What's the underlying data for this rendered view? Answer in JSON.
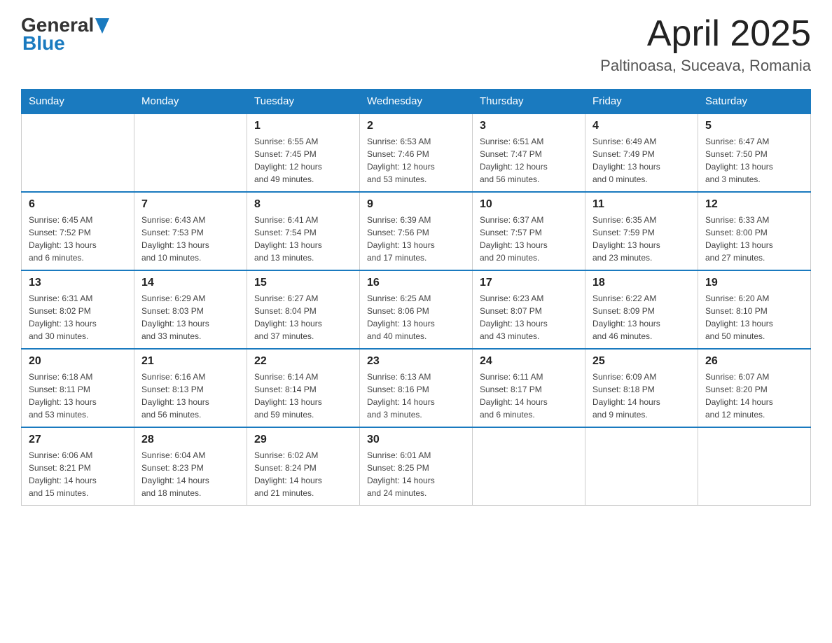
{
  "header": {
    "logo_general": "General",
    "logo_blue": "Blue",
    "month_title": "April 2025",
    "location": "Paltinoasa, Suceava, Romania"
  },
  "weekdays": [
    "Sunday",
    "Monday",
    "Tuesday",
    "Wednesday",
    "Thursday",
    "Friday",
    "Saturday"
  ],
  "weeks": [
    [
      {
        "day": "",
        "info": ""
      },
      {
        "day": "",
        "info": ""
      },
      {
        "day": "1",
        "info": "Sunrise: 6:55 AM\nSunset: 7:45 PM\nDaylight: 12 hours\nand 49 minutes."
      },
      {
        "day": "2",
        "info": "Sunrise: 6:53 AM\nSunset: 7:46 PM\nDaylight: 12 hours\nand 53 minutes."
      },
      {
        "day": "3",
        "info": "Sunrise: 6:51 AM\nSunset: 7:47 PM\nDaylight: 12 hours\nand 56 minutes."
      },
      {
        "day": "4",
        "info": "Sunrise: 6:49 AM\nSunset: 7:49 PM\nDaylight: 13 hours\nand 0 minutes."
      },
      {
        "day": "5",
        "info": "Sunrise: 6:47 AM\nSunset: 7:50 PM\nDaylight: 13 hours\nand 3 minutes."
      }
    ],
    [
      {
        "day": "6",
        "info": "Sunrise: 6:45 AM\nSunset: 7:52 PM\nDaylight: 13 hours\nand 6 minutes."
      },
      {
        "day": "7",
        "info": "Sunrise: 6:43 AM\nSunset: 7:53 PM\nDaylight: 13 hours\nand 10 minutes."
      },
      {
        "day": "8",
        "info": "Sunrise: 6:41 AM\nSunset: 7:54 PM\nDaylight: 13 hours\nand 13 minutes."
      },
      {
        "day": "9",
        "info": "Sunrise: 6:39 AM\nSunset: 7:56 PM\nDaylight: 13 hours\nand 17 minutes."
      },
      {
        "day": "10",
        "info": "Sunrise: 6:37 AM\nSunset: 7:57 PM\nDaylight: 13 hours\nand 20 minutes."
      },
      {
        "day": "11",
        "info": "Sunrise: 6:35 AM\nSunset: 7:59 PM\nDaylight: 13 hours\nand 23 minutes."
      },
      {
        "day": "12",
        "info": "Sunrise: 6:33 AM\nSunset: 8:00 PM\nDaylight: 13 hours\nand 27 minutes."
      }
    ],
    [
      {
        "day": "13",
        "info": "Sunrise: 6:31 AM\nSunset: 8:02 PM\nDaylight: 13 hours\nand 30 minutes."
      },
      {
        "day": "14",
        "info": "Sunrise: 6:29 AM\nSunset: 8:03 PM\nDaylight: 13 hours\nand 33 minutes."
      },
      {
        "day": "15",
        "info": "Sunrise: 6:27 AM\nSunset: 8:04 PM\nDaylight: 13 hours\nand 37 minutes."
      },
      {
        "day": "16",
        "info": "Sunrise: 6:25 AM\nSunset: 8:06 PM\nDaylight: 13 hours\nand 40 minutes."
      },
      {
        "day": "17",
        "info": "Sunrise: 6:23 AM\nSunset: 8:07 PM\nDaylight: 13 hours\nand 43 minutes."
      },
      {
        "day": "18",
        "info": "Sunrise: 6:22 AM\nSunset: 8:09 PM\nDaylight: 13 hours\nand 46 minutes."
      },
      {
        "day": "19",
        "info": "Sunrise: 6:20 AM\nSunset: 8:10 PM\nDaylight: 13 hours\nand 50 minutes."
      }
    ],
    [
      {
        "day": "20",
        "info": "Sunrise: 6:18 AM\nSunset: 8:11 PM\nDaylight: 13 hours\nand 53 minutes."
      },
      {
        "day": "21",
        "info": "Sunrise: 6:16 AM\nSunset: 8:13 PM\nDaylight: 13 hours\nand 56 minutes."
      },
      {
        "day": "22",
        "info": "Sunrise: 6:14 AM\nSunset: 8:14 PM\nDaylight: 13 hours\nand 59 minutes."
      },
      {
        "day": "23",
        "info": "Sunrise: 6:13 AM\nSunset: 8:16 PM\nDaylight: 14 hours\nand 3 minutes."
      },
      {
        "day": "24",
        "info": "Sunrise: 6:11 AM\nSunset: 8:17 PM\nDaylight: 14 hours\nand 6 minutes."
      },
      {
        "day": "25",
        "info": "Sunrise: 6:09 AM\nSunset: 8:18 PM\nDaylight: 14 hours\nand 9 minutes."
      },
      {
        "day": "26",
        "info": "Sunrise: 6:07 AM\nSunset: 8:20 PM\nDaylight: 14 hours\nand 12 minutes."
      }
    ],
    [
      {
        "day": "27",
        "info": "Sunrise: 6:06 AM\nSunset: 8:21 PM\nDaylight: 14 hours\nand 15 minutes."
      },
      {
        "day": "28",
        "info": "Sunrise: 6:04 AM\nSunset: 8:23 PM\nDaylight: 14 hours\nand 18 minutes."
      },
      {
        "day": "29",
        "info": "Sunrise: 6:02 AM\nSunset: 8:24 PM\nDaylight: 14 hours\nand 21 minutes."
      },
      {
        "day": "30",
        "info": "Sunrise: 6:01 AM\nSunset: 8:25 PM\nDaylight: 14 hours\nand 24 minutes."
      },
      {
        "day": "",
        "info": ""
      },
      {
        "day": "",
        "info": ""
      },
      {
        "day": "",
        "info": ""
      }
    ]
  ]
}
